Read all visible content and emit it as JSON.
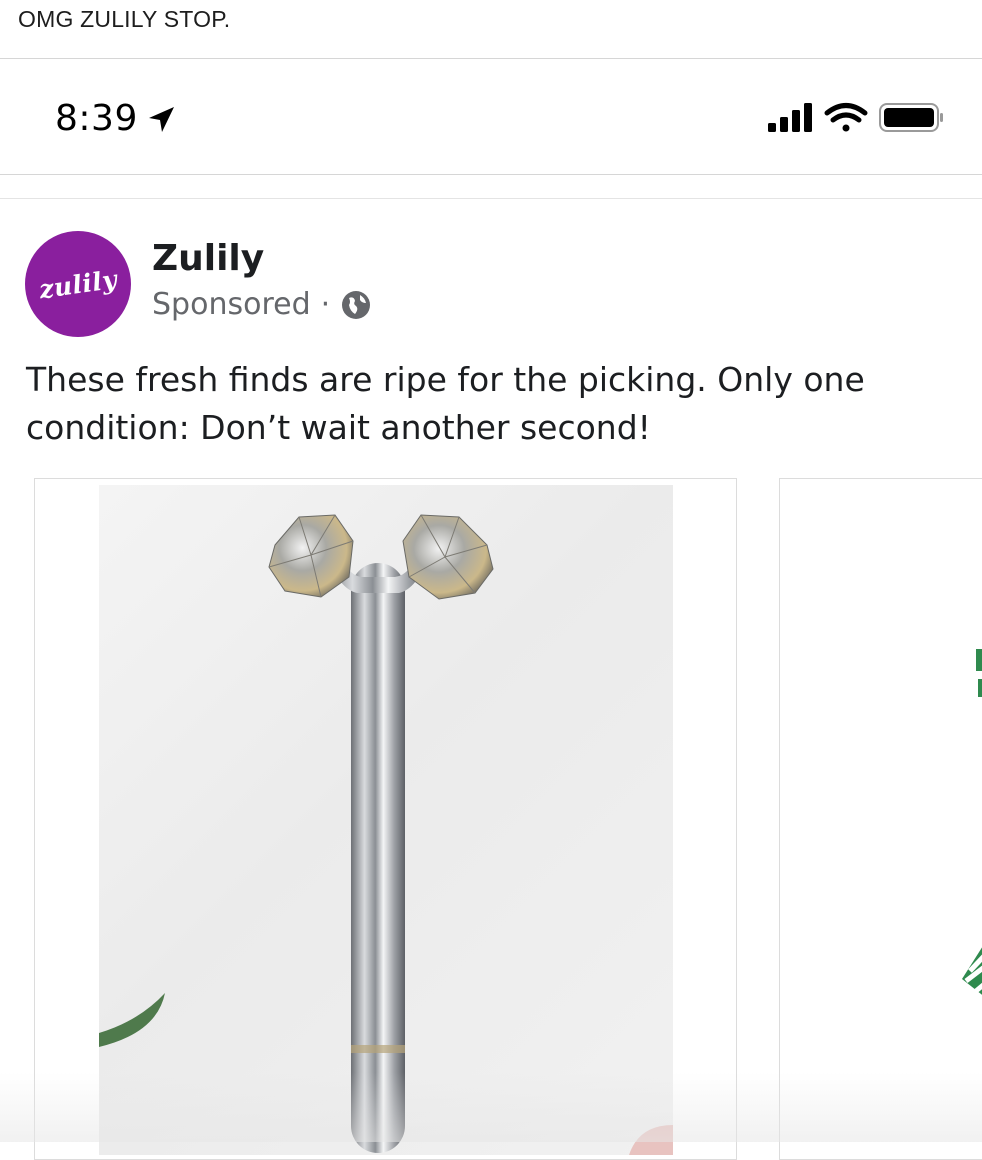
{
  "caption": "OMG ZULILY STOP.",
  "status_bar": {
    "time": "8:39",
    "icons": [
      "location-arrow-icon",
      "signal-bars-icon",
      "wifi-icon",
      "battery-icon"
    ]
  },
  "post": {
    "page_name": "Zulily",
    "avatar_text": "zulily",
    "sponsored_label": "Sponsored",
    "separator": "·",
    "privacy_icon": "globe-icon",
    "text": "These fresh finds are ripe for the picking. Only one condition: Don’t wait another second!",
    "brand_color": "#8a1f9e"
  },
  "carousel": {
    "cards": [
      {
        "image": "silver-facial-roller-image"
      },
      {
        "image": "green-striped-product-image"
      }
    ]
  }
}
